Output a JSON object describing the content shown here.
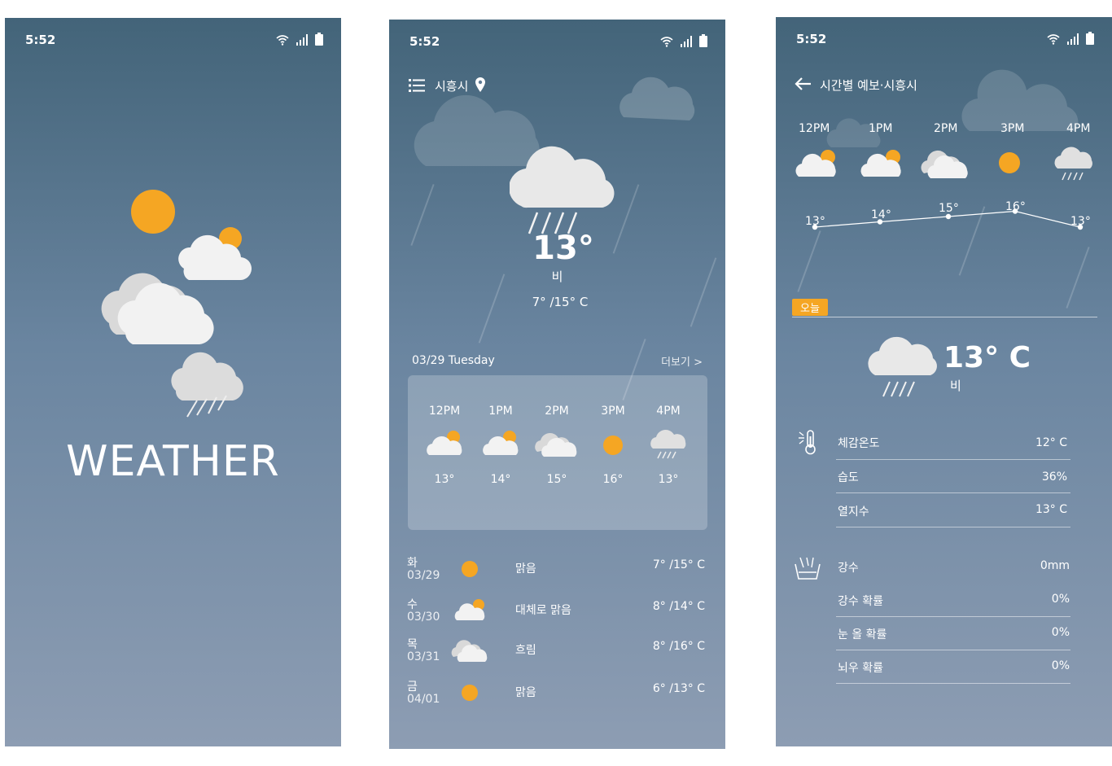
{
  "status": {
    "time": "5:52"
  },
  "splash": {
    "title": "WEATHER"
  },
  "main": {
    "location": "시흥시",
    "current_temp": "13°",
    "condition": "비",
    "low_high": "7° /15° C",
    "date": "03/29 Tuesday",
    "more_label": "더보기 >",
    "hourly": [
      {
        "time": "12PM",
        "icon": "partly-cloudy-icon",
        "temp": "13°"
      },
      {
        "time": "1PM",
        "icon": "partly-cloudy-icon",
        "temp": "14°"
      },
      {
        "time": "2PM",
        "icon": "cloudy-icon",
        "temp": "15°"
      },
      {
        "time": "3PM",
        "icon": "sun-icon",
        "temp": "16°"
      },
      {
        "time": "4PM",
        "icon": "rain-icon",
        "temp": "13°"
      }
    ],
    "daily": [
      {
        "day": "화",
        "date": "03/29",
        "icon": "sun-icon",
        "desc": "맑음",
        "temps": "7° /15° C"
      },
      {
        "day": "수",
        "date": "03/30",
        "icon": "partly-cloudy-icon",
        "desc": "대체로 맑음",
        "temps": "8° /14° C"
      },
      {
        "day": "목",
        "date": "03/31",
        "icon": "cloudy-icon",
        "desc": "흐림",
        "temps": "8° /16° C"
      },
      {
        "day": "금",
        "date": "04/01",
        "icon": "sun-icon",
        "desc": "맑음",
        "temps": "6° /13° C"
      }
    ]
  },
  "hourly_page": {
    "title": "시간별 예보·시흥시",
    "hours": [
      {
        "time": "12PM",
        "icon": "partly-cloudy-icon",
        "temp": "13°",
        "value": 13
      },
      {
        "time": "1PM",
        "icon": "partly-cloudy-icon",
        "temp": "14°",
        "value": 14
      },
      {
        "time": "2PM",
        "icon": "cloudy-icon",
        "temp": "15°",
        "value": 15
      },
      {
        "time": "3PM",
        "icon": "sun-icon",
        "temp": "16°",
        "value": 16
      },
      {
        "time": "4PM",
        "icon": "rain-icon",
        "temp": "13°",
        "value": 13
      }
    ],
    "today_badge": "오늘",
    "current_temp": "13° C",
    "condition": "비",
    "details": [
      {
        "label": "체감온도",
        "value": "12° C"
      },
      {
        "label": "습도",
        "value": "36%"
      },
      {
        "label": "열지수",
        "value": "13° C"
      }
    ],
    "precip": [
      {
        "label": "강수",
        "value": "0mm"
      },
      {
        "label": "강수 확률",
        "value": "0%"
      },
      {
        "label": "눈 올 확률",
        "value": "0%"
      },
      {
        "label": "뇌우 확률",
        "value": "0%"
      }
    ]
  },
  "colors": {
    "sun": "#f5a623",
    "cloud": "#f2f2f2",
    "badge": "#f5a623"
  }
}
